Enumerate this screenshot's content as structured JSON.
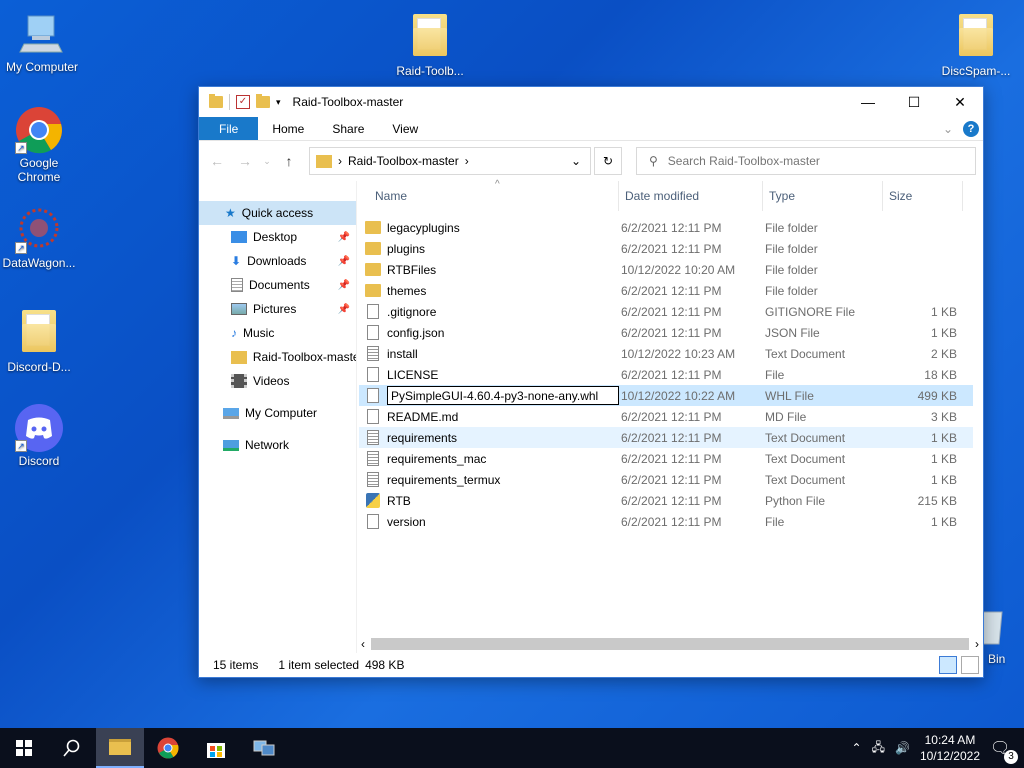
{
  "desktop": {
    "icons": [
      {
        "label": "My Computer",
        "icon": "computer-icon"
      },
      {
        "label": "Google Chrome",
        "icon": "chrome-icon"
      },
      {
        "label": "DataWagon...",
        "icon": "datawagon-icon"
      },
      {
        "label": "Discord-D...",
        "icon": "folder-icon"
      },
      {
        "label": "Discord",
        "icon": "discord-icon"
      },
      {
        "label": "Raid-Toolb...",
        "icon": "folder-icon"
      },
      {
        "label": "DiscSpam-...",
        "icon": "folder-icon"
      },
      {
        "label": "Bin",
        "icon": "recycle-bin-icon"
      }
    ]
  },
  "window": {
    "title": "Raid-Toolbox-master",
    "controls": {
      "minimize": "—",
      "maximize": "☐",
      "close": "✕"
    },
    "ribbon_tabs": [
      "File",
      "Home",
      "Share",
      "View"
    ],
    "breadcrumb": "Raid-Toolbox-master",
    "search_placeholder": "Search Raid-Toolbox-master"
  },
  "navpane": {
    "items": [
      {
        "label": "Quick access",
        "icon": "star-icon",
        "pinned": false
      },
      {
        "label": "Desktop",
        "icon": "desktop-icon",
        "pinned": true
      },
      {
        "label": "Downloads",
        "icon": "download-icon",
        "pinned": true
      },
      {
        "label": "Documents",
        "icon": "documents-icon",
        "pinned": true
      },
      {
        "label": "Pictures",
        "icon": "pictures-icon",
        "pinned": true
      },
      {
        "label": "Music",
        "icon": "music-icon",
        "pinned": false
      },
      {
        "label": "Raid-Toolbox-maste",
        "icon": "folder-icon",
        "pinned": false
      },
      {
        "label": "Videos",
        "icon": "videos-icon",
        "pinned": false
      },
      {
        "label": "My Computer",
        "icon": "computer-icon",
        "pinned": false
      },
      {
        "label": "Network",
        "icon": "network-icon",
        "pinned": false
      }
    ]
  },
  "columns": {
    "name": "Name",
    "date": "Date modified",
    "type": "Type",
    "size": "Size"
  },
  "files": [
    {
      "name": "legacyplugins",
      "date": "6/2/2021 12:11 PM",
      "type": "File folder",
      "size": "",
      "icon": "folder"
    },
    {
      "name": "plugins",
      "date": "6/2/2021 12:11 PM",
      "type": "File folder",
      "size": "",
      "icon": "folder"
    },
    {
      "name": "RTBFiles",
      "date": "10/12/2022 10:20 AM",
      "type": "File folder",
      "size": "",
      "icon": "folder"
    },
    {
      "name": "themes",
      "date": "6/2/2021 12:11 PM",
      "type": "File folder",
      "size": "",
      "icon": "folder"
    },
    {
      "name": ".gitignore",
      "date": "6/2/2021 12:11 PM",
      "type": "GITIGNORE File",
      "size": "1 KB",
      "icon": "file"
    },
    {
      "name": "config.json",
      "date": "6/2/2021 12:11 PM",
      "type": "JSON File",
      "size": "1 KB",
      "icon": "file"
    },
    {
      "name": "install",
      "date": "10/12/2022 10:23 AM",
      "type": "Text Document",
      "size": "2 KB",
      "icon": "text"
    },
    {
      "name": "LICENSE",
      "date": "6/2/2021 12:11 PM",
      "type": "File",
      "size": "18 KB",
      "icon": "file"
    },
    {
      "name": "PySimpleGUI-4.60.4-py3-none-any.whl",
      "date": "10/12/2022 10:22 AM",
      "type": "WHL File",
      "size": "499 KB",
      "icon": "file",
      "selected": true,
      "renaming": true
    },
    {
      "name": "README.md",
      "date": "6/2/2021 12:11 PM",
      "type": "MD File",
      "size": "3 KB",
      "icon": "file"
    },
    {
      "name": "requirements",
      "date": "6/2/2021 12:11 PM",
      "type": "Text Document",
      "size": "1 KB",
      "icon": "text",
      "hover": true
    },
    {
      "name": "requirements_mac",
      "date": "6/2/2021 12:11 PM",
      "type": "Text Document",
      "size": "1 KB",
      "icon": "text"
    },
    {
      "name": "requirements_termux",
      "date": "6/2/2021 12:11 PM",
      "type": "Text Document",
      "size": "1 KB",
      "icon": "text"
    },
    {
      "name": "RTB",
      "date": "6/2/2021 12:11 PM",
      "type": "Python File",
      "size": "215 KB",
      "icon": "python"
    },
    {
      "name": "version",
      "date": "6/2/2021 12:11 PM",
      "type": "File",
      "size": "1 KB",
      "icon": "file"
    }
  ],
  "status": {
    "count": "15 items",
    "selection": "1 item selected",
    "size": "498 KB"
  },
  "taskbar": {
    "time": "10:24 AM",
    "date": "10/12/2022",
    "notifications": "3"
  }
}
